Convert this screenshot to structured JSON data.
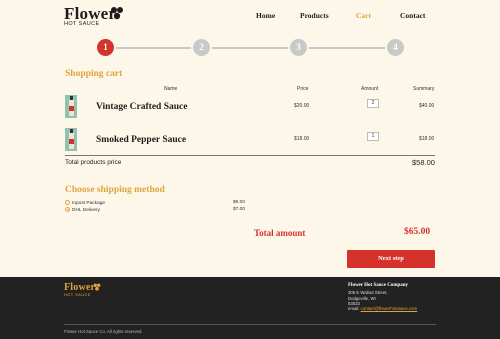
{
  "brand": {
    "name": "Flower",
    "tagline": "HOT SAUCE"
  },
  "nav": {
    "items": [
      "Home",
      "Products",
      "Cart",
      "Contact"
    ],
    "active": "Cart"
  },
  "stepper": {
    "steps": [
      "1",
      "2",
      "3",
      "4"
    ],
    "current": 1
  },
  "cart": {
    "title": "Shopping cart",
    "headers": {
      "name": "Name",
      "price": "Price",
      "amount": "Amount",
      "summary": "Summary"
    },
    "items": [
      {
        "name": "Vintage Crafted Sauce",
        "price": "$20.00",
        "amount": "2",
        "summary": "$40.00"
      },
      {
        "name": "Smoked Pepper Sauce",
        "price": "$18.00",
        "amount": "1",
        "summary": "$18.00"
      }
    ],
    "total_label": "Total products price",
    "total_value": "$58.00"
  },
  "shipping": {
    "title": "Choose shipping method",
    "options": [
      {
        "label": "Inpost Package",
        "price": "$6.00",
        "selected": false
      },
      {
        "label": "DHL Delivery",
        "price": "$7.00",
        "selected": true
      }
    ]
  },
  "totals": {
    "label": "Total amount",
    "value": "$65.00"
  },
  "next_button": "Next step",
  "footer": {
    "brand": "Flower",
    "tagline": "HOT SAUCE",
    "company": "Flower Hot Sauce Company",
    "address1": "305 E Walnut Street,",
    "address2": "Dodgeville, WI",
    "zip": "53533",
    "email_label": "email:",
    "email": "contact@flowerhotsauce.com",
    "copyright": "Flower Hot Sauce Co. All rights reserved."
  },
  "colors": {
    "accent": "#e0a33c",
    "red": "#d5322c",
    "background": "#fdf7e9",
    "footer": "#222222"
  }
}
